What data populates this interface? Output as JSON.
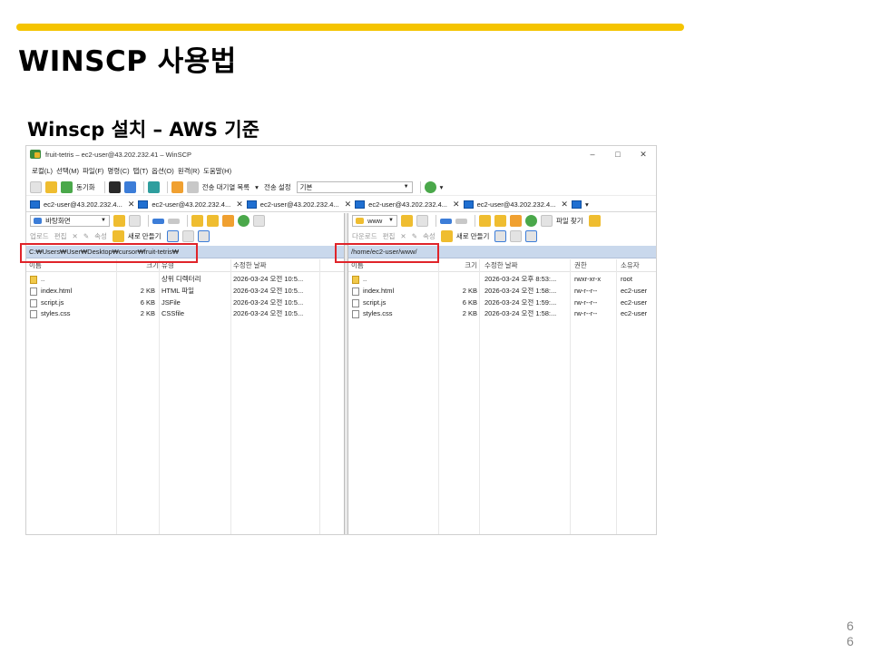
{
  "slide": {
    "title": "WINSCP 사용법",
    "subtitle": "Winscp 설치 – AWS 기준",
    "page_number_top": "6",
    "page_number_bottom": "6",
    "accent_color": "#f5c400"
  },
  "window": {
    "title": "fruit-tetris – ec2-user@43.202.232.41 – WinSCP",
    "minimize": "–",
    "maximize": "□",
    "close": "✕",
    "menu": [
      "로컬(L)",
      "선택(M)",
      "파일(F)",
      "명령(C)",
      "탭(T)",
      "옵션(O)",
      "원격(R)",
      "도움말(H)"
    ],
    "toolbar": {
      "sync_label": "동기화",
      "queue_label": "전송 대기열 목록",
      "transfer_settings_label": "전송 설정",
      "transfer_settings_value": "기본"
    },
    "tabs": [
      {
        "label": "ec2-user@43.202.232.4..."
      },
      {
        "label": "ec2-user@43.202.232.4..."
      },
      {
        "label": "ec2-user@43.202.232.4..."
      },
      {
        "label": "ec2-user@43.202.232.4..."
      },
      {
        "label": "ec2-user@43.202.232.4..."
      }
    ],
    "tab_close": "✕"
  },
  "left_pane": {
    "location": "바탕화면",
    "upload_label": "업로드",
    "edit_label": "편집",
    "properties_label": "속성",
    "new_label": "새로 만들기",
    "path": "C:₩Users₩User₩Desktop₩cursor₩fruit-tetris₩",
    "columns": [
      "이름",
      "크기",
      "유형",
      "수정한 날짜"
    ],
    "rows": [
      {
        "name": "..",
        "size": "",
        "type": "상위 디렉터리",
        "modified": "2026-03-24 오전 10:5..."
      },
      {
        "name": "index.html",
        "size": "2 KB",
        "type": "HTML 파일",
        "modified": "2026-03-24 오전 10:5..."
      },
      {
        "name": "script.js",
        "size": "6 KB",
        "type": "JSFile",
        "modified": "2026-03-24 오전 10:5..."
      },
      {
        "name": "styles.css",
        "size": "2 KB",
        "type": "CSSfile",
        "modified": "2026-03-24 오전 10:5..."
      }
    ]
  },
  "right_pane": {
    "location": "www",
    "find_files_label": "파일 찾기",
    "download_label": "다운로드",
    "edit_label": "편집",
    "properties_label": "속성",
    "new_label": "새로 만들기",
    "path": "/home/ec2-user/www/",
    "columns": [
      "이름",
      "크기",
      "수정한 날짜",
      "권한",
      "소유자"
    ],
    "rows": [
      {
        "name": "..",
        "size": "",
        "modified": "2026-03-24 오후 8:53:...",
        "permissions": "rwxr-xr-x",
        "owner": "root"
      },
      {
        "name": "index.html",
        "size": "2 KB",
        "modified": "2026-03-24 오전 1:58:...",
        "permissions": "rw-r--r--",
        "owner": "ec2-user"
      },
      {
        "name": "script.js",
        "size": "6 KB",
        "modified": "2026-03-24 오전 1:59:...",
        "permissions": "rw-r--r--",
        "owner": "ec2-user"
      },
      {
        "name": "styles.css",
        "size": "2 KB",
        "modified": "2026-03-24 오전 1:58:...",
        "permissions": "rw-r--r--",
        "owner": "ec2-user"
      }
    ]
  },
  "highlight_color": "#e0242a"
}
